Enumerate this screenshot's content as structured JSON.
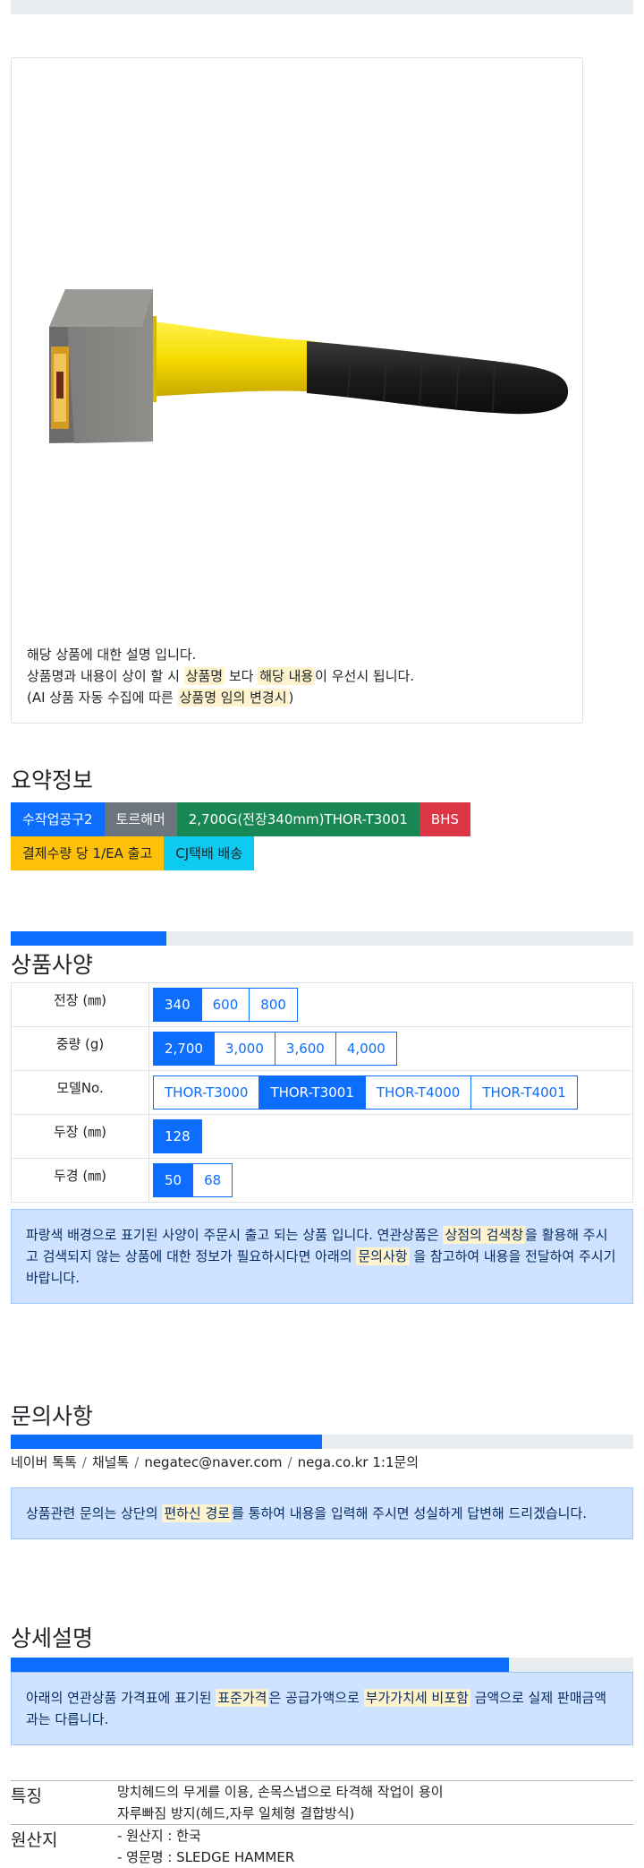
{
  "image_card": {
    "desc_line1": "해당 상품에 대한 설명 입니다.",
    "desc_line2_a": "상품명과 내용이 상이 할 시 ",
    "desc_line2_b": "상품명",
    "desc_line2_c": " 보다 ",
    "desc_line2_d": "해당 내용",
    "desc_line2_e": "이 우선시 됩니다.",
    "desc_line3_a": "(AI 상품 자동 수집에 따른 ",
    "desc_line3_b": "상품명 임의 변경시",
    "desc_line3_c": ")"
  },
  "summary": {
    "title": "요약정보",
    "badges": [
      "수작업공구2",
      "토르해머",
      "2,700G(전장340mm)THOR-T3001",
      "BHS",
      "결제수량 당 1/EA 출고",
      "CJ택배 배송"
    ]
  },
  "spec": {
    "title": "상품사양",
    "progress_percent": 25,
    "rows": [
      {
        "label": "전장 (㎜)",
        "options": [
          "340",
          "600",
          "800"
        ],
        "selected": "340"
      },
      {
        "label": "중량 (g)",
        "options": [
          "2,700",
          "3,000",
          "3,600",
          "4,000"
        ],
        "selected": "2,700"
      },
      {
        "label": "모델No.",
        "options": [
          "THOR-T3000",
          "THOR-T3001",
          "THOR-T4000",
          "THOR-T4001"
        ],
        "selected": "THOR-T3001"
      },
      {
        "label": "두장 (㎜)",
        "options": [
          "128"
        ],
        "selected": "128"
      },
      {
        "label": "두경 (㎜)",
        "options": [
          "50",
          "68"
        ],
        "selected": "50"
      }
    ],
    "notice_a": "파랑색 배경으로 표기된 사양이 주문시 출고 되는 상품 입니다. 연관상품은 ",
    "notice_b": "상점의 검색창",
    "notice_c": "을 활용해 주시고 검색되지 않는 상품에 대한 정보가 필요하시다면 아래의 ",
    "notice_d": "문의사항",
    "notice_e": " 을 참고하여 내용을 전달하여 주시기 바랍니다."
  },
  "inquiry": {
    "title": "문의사항",
    "progress_percent": 50,
    "channels": [
      "네이버 톡톡",
      "채널톡",
      "negatec@naver.com",
      "nega.co.kr 1:1문의"
    ],
    "separator": "/",
    "notice_a": "상품관련 문의는 상단의 ",
    "notice_b": "편하신 경로",
    "notice_c": "를 통하여 내용을 입력해 주시면 성실하게 답변해 드리겠습니다."
  },
  "detail": {
    "title": "상세설명",
    "progress_percent": 80,
    "notice_a": "아래의 연관상품 가격표에 표기된 ",
    "notice_b": "표준가격",
    "notice_c": "은 공급가액으로 ",
    "notice_d": "부가가치세 비포함",
    "notice_e": " 금액으로 실제 판매금액과는 다릅니다.",
    "features": [
      {
        "label": "특징",
        "lines": [
          "망치헤드의 무게를 이용, 손목스냅으로 타격해 작업이 용이",
          "자루빠짐 방지(헤드,자루 일체형 결합방식)"
        ]
      },
      {
        "label": "원산지",
        "lines": [
          "- 원산지 : 한국",
          "- 영문명 : SLEDGE HAMMER"
        ]
      }
    ]
  },
  "colors": {
    "accent": "#0d6efd",
    "bar_bg": "#e9ecef",
    "highlight": "#fff3cd",
    "alert_bg": "#cfe2ff"
  }
}
